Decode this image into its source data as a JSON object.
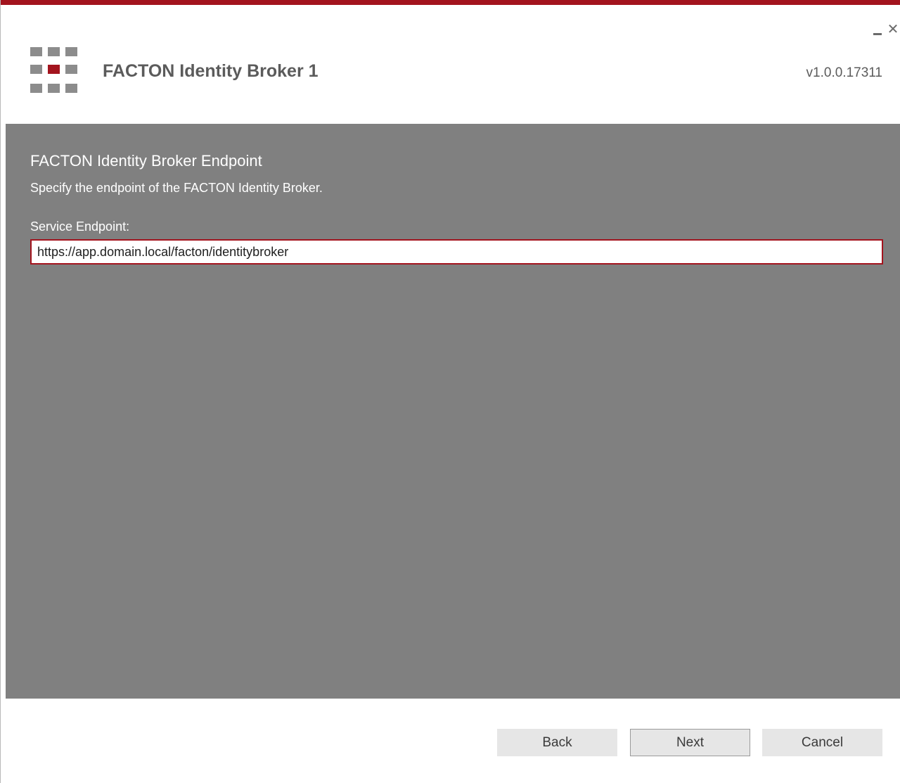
{
  "window": {
    "minimize_icon": "minimize-icon",
    "close_icon": "close-icon",
    "close_glyph": "✕"
  },
  "header": {
    "title": "FACTON Identity Broker 1",
    "version": "v1.0.0.17311",
    "logo_icon": "facton-grid-logo",
    "brand_color": "#a3141e"
  },
  "content": {
    "section_title": "FACTON Identity Broker Endpoint",
    "section_description": "Specify the endpoint of the FACTON Identity Broker.",
    "service_endpoint_label": "Service Endpoint:",
    "service_endpoint_value": "https://app.domain.local/facton/identitybroker"
  },
  "footer": {
    "back_label": "Back",
    "next_label": "Next",
    "cancel_label": "Cancel"
  }
}
